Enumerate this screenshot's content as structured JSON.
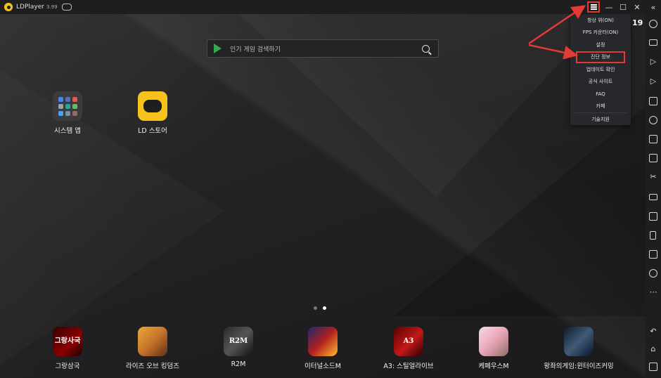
{
  "window": {
    "title": "LDPlayer",
    "version": "3.99",
    "clock": "19"
  },
  "search": {
    "placeholder": "인기 게임 검색하기"
  },
  "desktop_apps": [
    {
      "label": "시스템 앱",
      "icon": "system-apps-icon"
    },
    {
      "label": "LD 스토어",
      "icon": "ld-store-icon"
    }
  ],
  "dock_apps": [
    {
      "label": "그랑삼국",
      "icon_text": "그랑사국"
    },
    {
      "label": "라이즈 오브 킹덤즈",
      "icon_text": ""
    },
    {
      "label": "R2M",
      "icon_text": "R2M"
    },
    {
      "label": "이터널소드M",
      "icon_text": ""
    },
    {
      "label": "A3: 스틸얼라이브",
      "icon_text": "A3"
    },
    {
      "label": "케페우스M",
      "icon_text": ""
    },
    {
      "label": "왕좌의게임:윈터이즈커밍",
      "icon_text": ""
    }
  ],
  "page_dots": {
    "count": 2,
    "active": 2
  },
  "menu": {
    "items": [
      "항상 위(ON)",
      "FPS 카운터(ON)",
      "설정",
      "진단 정보",
      "업데이트 확인",
      "공식 사이트",
      "FAQ",
      "카페",
      "기술지원"
    ],
    "highlighted_index": 3
  },
  "sidebar_icons": [
    "gear-icon",
    "keyboard-icon",
    "volume-up-icon",
    "volume-down-icon",
    "screenshot-icon",
    "record-icon",
    "apk-icon",
    "folder-icon",
    "scissors-icon",
    "video-icon",
    "sync-icon",
    "shake-icon",
    "display-icon",
    "location-icon",
    "more-icon",
    "back-icon",
    "home-icon",
    "recent-apps-icon"
  ],
  "colors": {
    "annotation": "#e53935",
    "accent": "#f6c21b"
  }
}
